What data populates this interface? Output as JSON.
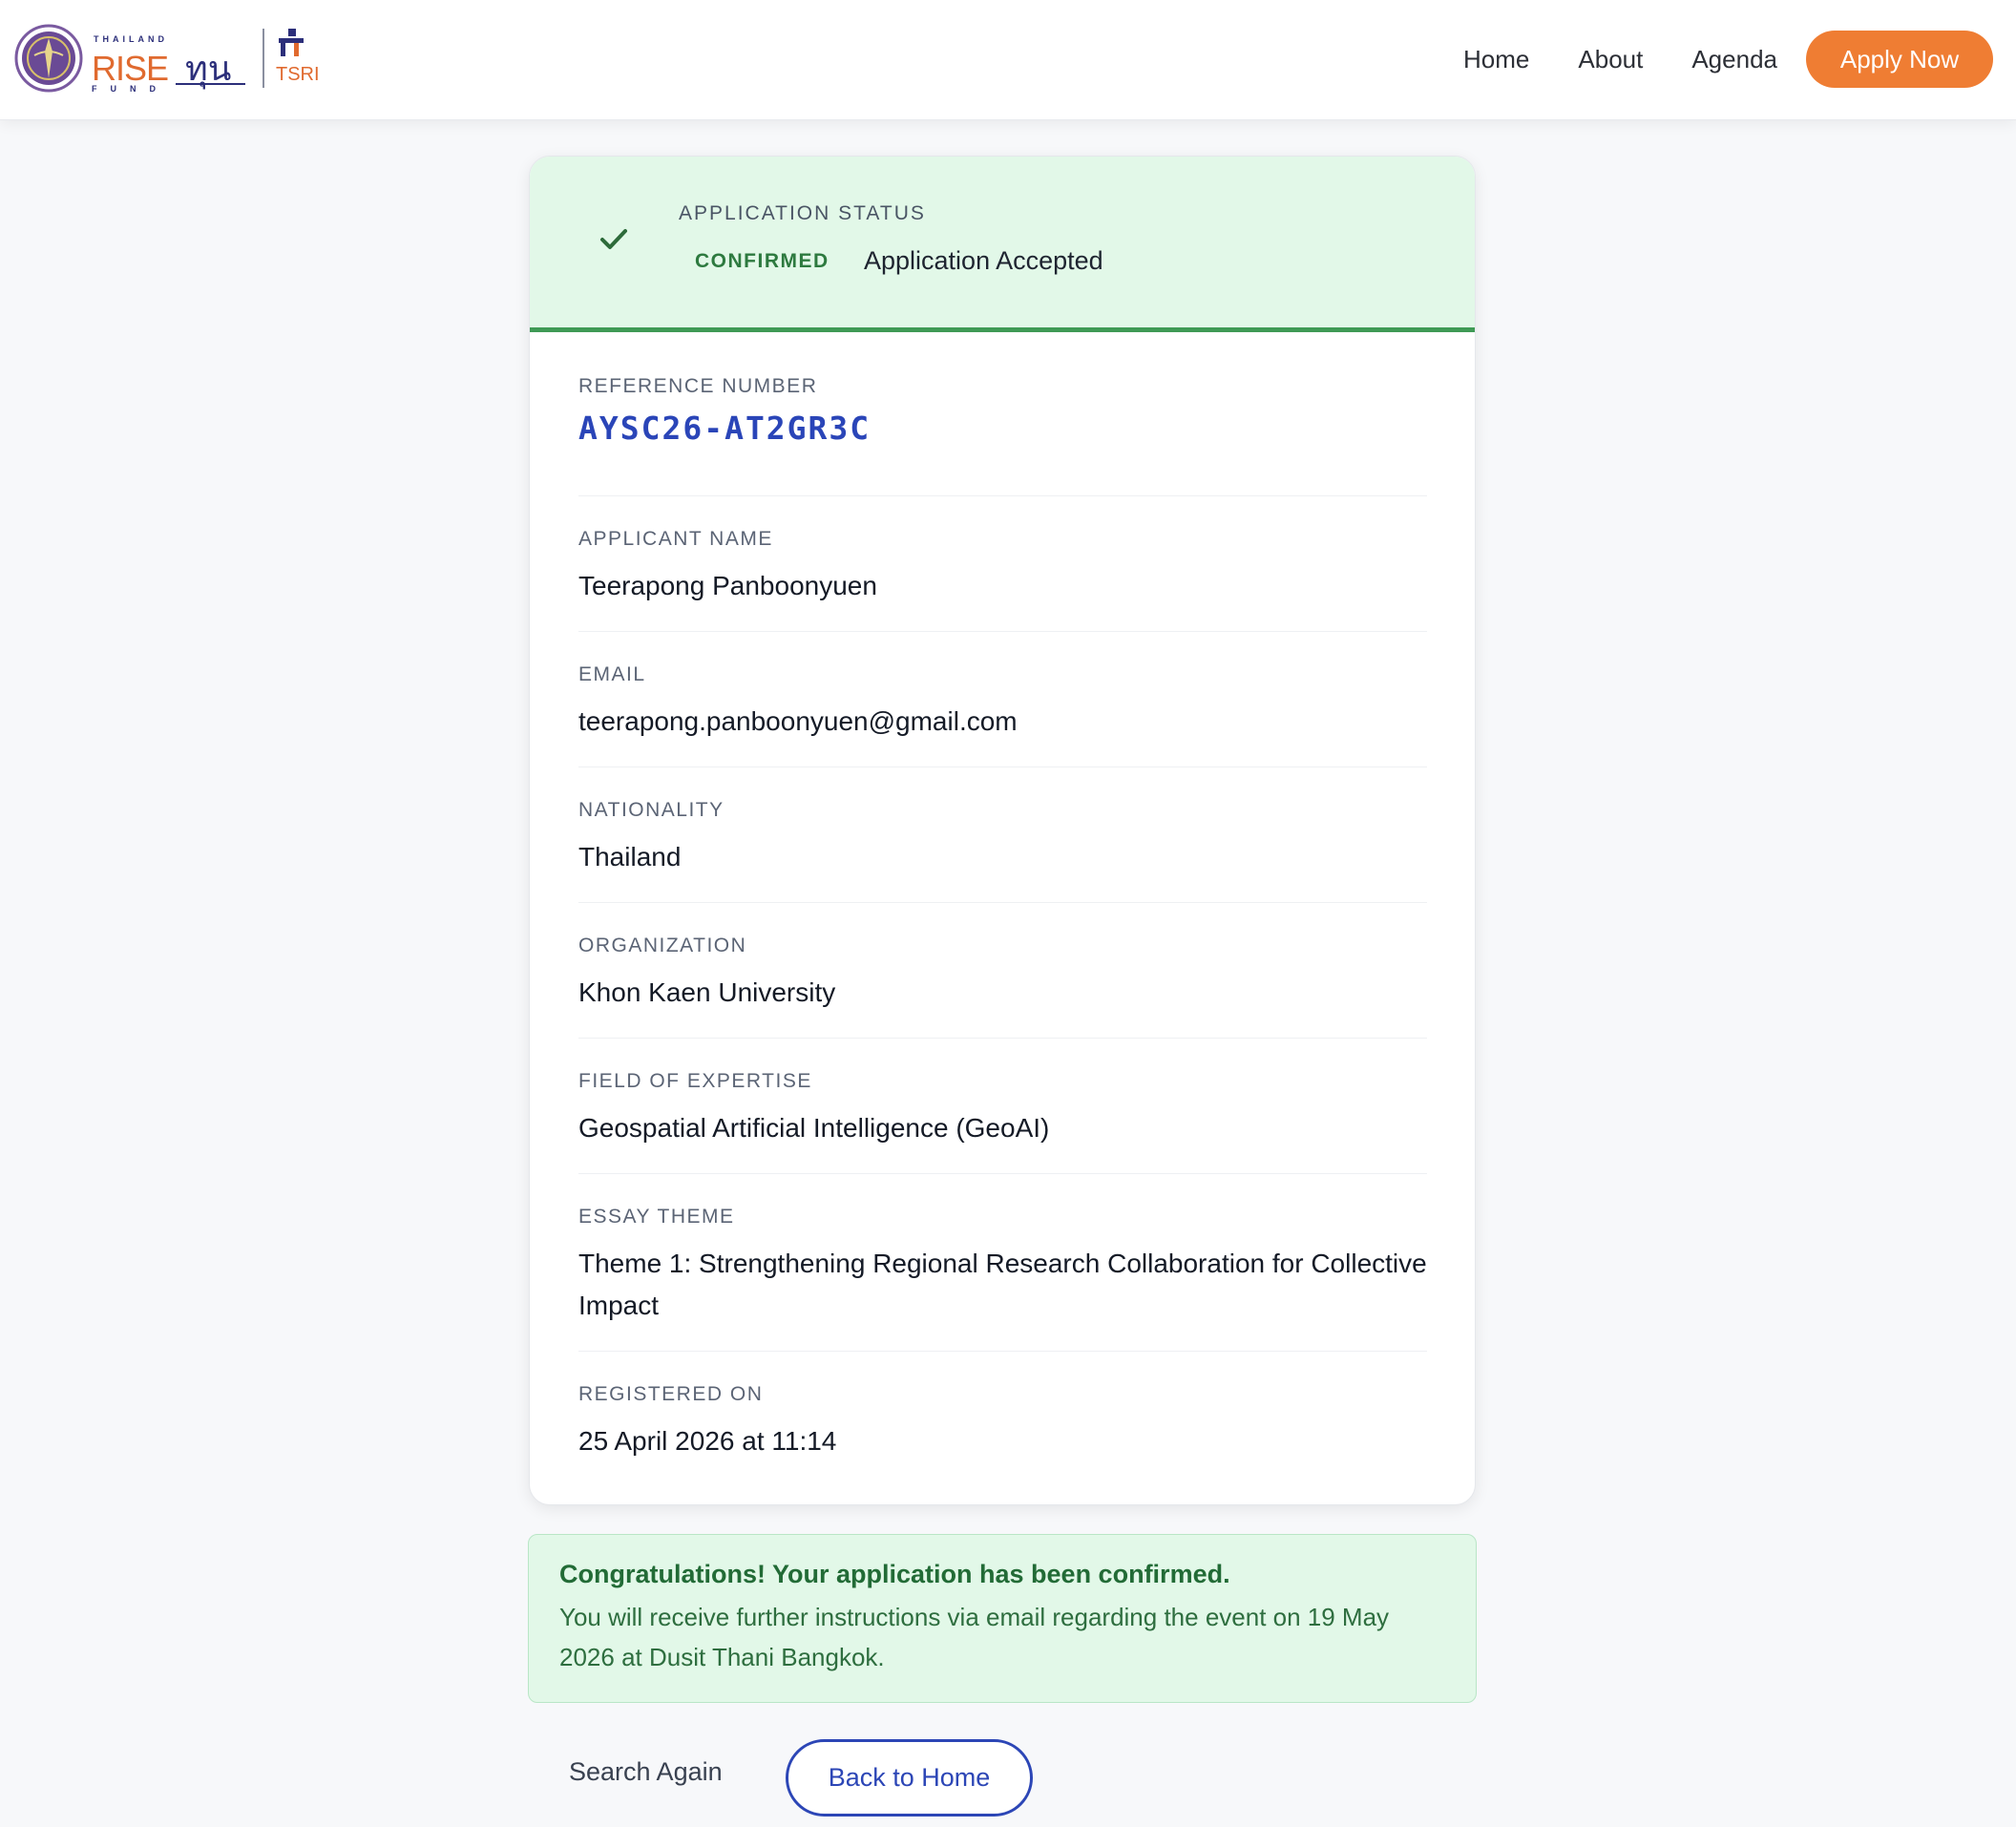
{
  "header": {
    "logo": {
      "word": "RISE",
      "thai_word": "ทุน",
      "top_text": "THAILAND",
      "bottom_text": "FUND",
      "partner": "TSRI"
    },
    "nav": [
      "Home",
      "About",
      "Agenda"
    ],
    "apply_label": "Apply Now"
  },
  "status": {
    "label": "APPLICATION STATUS",
    "badge": "CONFIRMED",
    "text": "Application Accepted",
    "icon": "checkmark-icon"
  },
  "fields": {
    "reference": {
      "label": "REFERENCE NUMBER",
      "value": "AYSC26-AT2GR3C"
    },
    "name": {
      "label": "APPLICANT NAME",
      "value": "Teerapong Panboonyuen"
    },
    "email": {
      "label": "EMAIL",
      "value": "teerapong.panboonyuen@gmail.com"
    },
    "nationality": {
      "label": "NATIONALITY",
      "value": "Thailand"
    },
    "organization": {
      "label": "ORGANIZATION",
      "value": "Khon Kaen University"
    },
    "field": {
      "label": "FIELD OF EXPERTISE",
      "value": "Geospatial Artificial Intelligence (GeoAI)"
    },
    "essay": {
      "label": "ESSAY THEME",
      "value": "Theme 1: Strengthening Regional Research Collaboration for Collective Impact"
    },
    "registered": {
      "label": "REGISTERED ON",
      "value": "25 April 2026 at 11:14"
    }
  },
  "message": {
    "title": "Congratulations! Your application has been confirmed.",
    "body": "You will receive further instructions via email regarding the event on 19 May 2026 at Dusit Thani Bangkok."
  },
  "actions": {
    "search_again": "Search Again",
    "back_home": "Back to Home"
  },
  "colors": {
    "accent_orange": "#ef7d33",
    "brand_blue": "#2c46b6",
    "success_green": "#3f9a55",
    "success_bg": "#e2f8e8"
  }
}
